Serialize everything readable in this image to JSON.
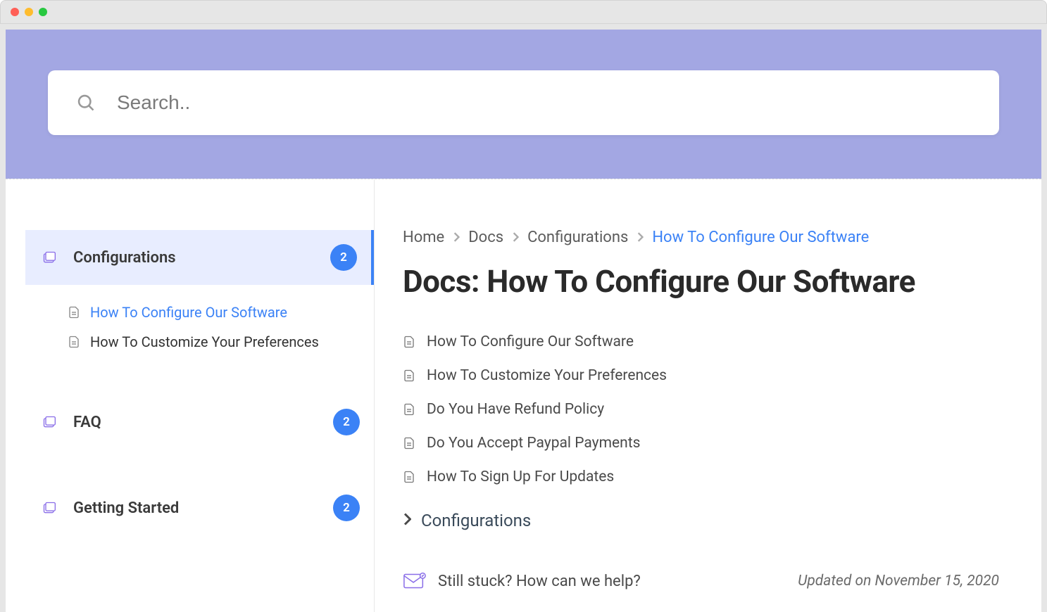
{
  "search": {
    "placeholder": "Search.."
  },
  "sidebar": {
    "categories": [
      {
        "label": "Configurations",
        "count": "2",
        "active": true,
        "children": [
          {
            "label": "How To Configure Our Software",
            "active": true
          },
          {
            "label": "How To Customize Your Preferences",
            "active": false
          }
        ]
      },
      {
        "label": "FAQ",
        "count": "2",
        "active": false,
        "children": []
      },
      {
        "label": "Getting Started",
        "count": "2",
        "active": false,
        "children": []
      }
    ]
  },
  "breadcrumb": [
    {
      "label": "Home",
      "active": false
    },
    {
      "label": "Docs",
      "active": false
    },
    {
      "label": "Configurations",
      "active": false
    },
    {
      "label": "How To Configure Our Software",
      "active": true
    }
  ],
  "page": {
    "title": "Docs: How To Configure Our Software"
  },
  "articles": [
    {
      "label": "How To Configure Our Software"
    },
    {
      "label": "How To Customize Your Preferences"
    },
    {
      "label": "Do You Have Refund Policy"
    },
    {
      "label": "Do You Accept Paypal Payments"
    },
    {
      "label": "How To Sign Up For Updates"
    }
  ],
  "category_link": {
    "label": "Configurations"
  },
  "help": {
    "text": "Still stuck? How can we help?"
  },
  "updated": {
    "text": "Updated on November 15, 2020"
  }
}
